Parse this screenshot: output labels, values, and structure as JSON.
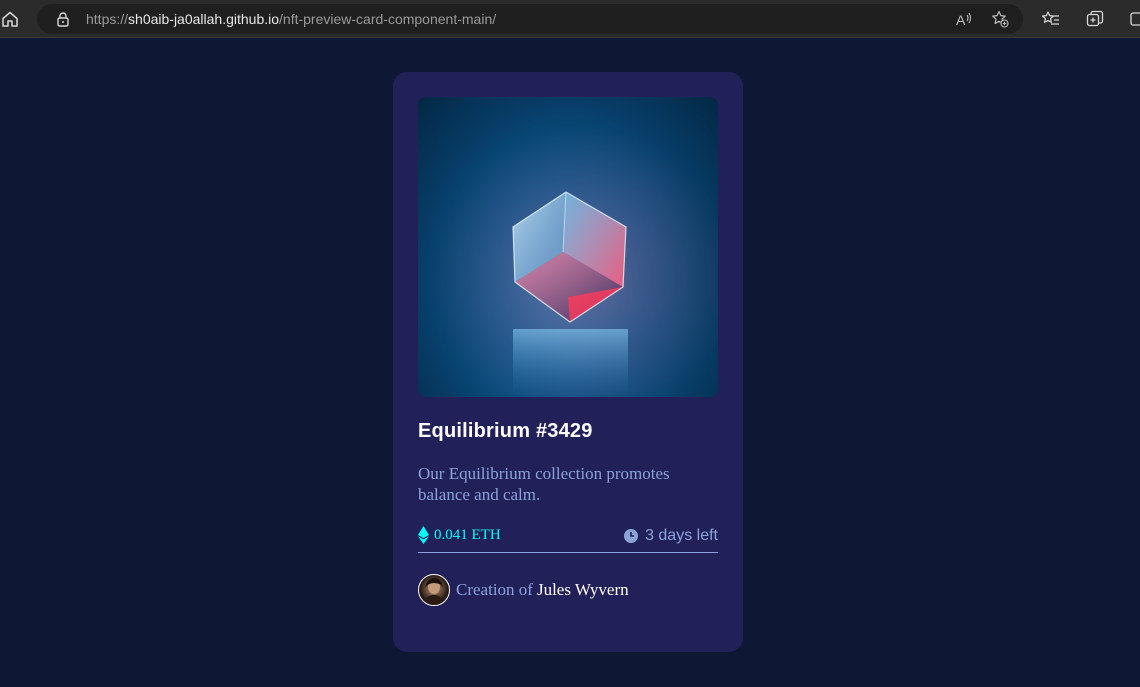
{
  "browser": {
    "url_prefix": "https://",
    "url_host": "sh0aib-ja0allah.github.io",
    "url_path": "/nft-preview-card-component-main/"
  },
  "card": {
    "title": "Equilibrium #3429",
    "description": "Our Equilibrium collection promotes balance and calm.",
    "price": "0.041 ETH",
    "time_left": "3 days left",
    "creator_prefix": "Creation of",
    "creator_name": "Jules Wyvern",
    "image": "equilibrium-cube-image"
  },
  "colors": {
    "page_background": "#0e1733",
    "card_background": "#222059",
    "accent_cyan": "#00fff8",
    "soft_blue": "#8aa3d9",
    "white": "#ffffff"
  },
  "icons": [
    "home-icon",
    "lock-icon",
    "read-aloud-icon",
    "add-favorite-icon",
    "favorites-icon",
    "collections-icon",
    "ethereum-icon",
    "clock-icon"
  ]
}
